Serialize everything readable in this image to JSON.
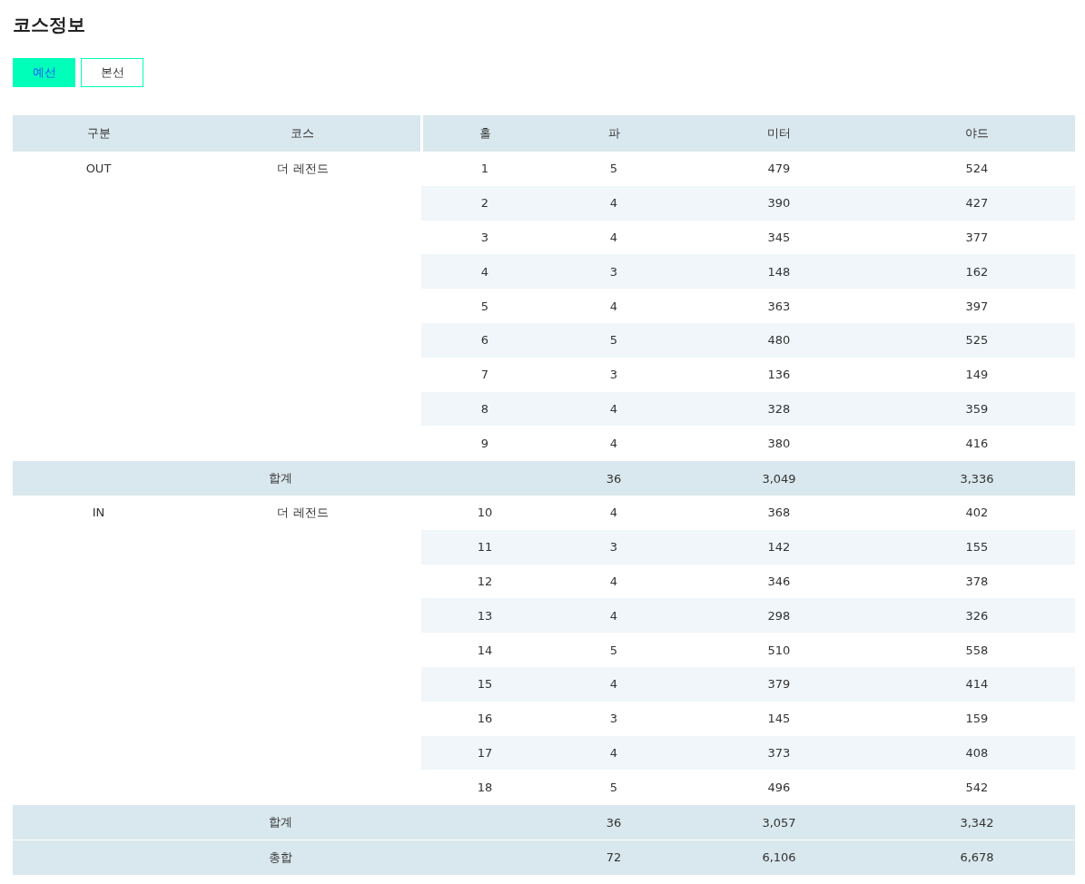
{
  "title": "코스정보",
  "tabs": [
    {
      "label": "예선",
      "selected": true
    },
    {
      "label": "본선",
      "selected": false
    }
  ],
  "table": {
    "columns": [
      "구분",
      "코스",
      "홀",
      "파",
      "미터",
      "야드"
    ],
    "sections": [
      {
        "division": "OUT",
        "course": "더 레전드",
        "rows": [
          {
            "hole": "1",
            "par": "5",
            "meter": "479",
            "yard": "524"
          },
          {
            "hole": "2",
            "par": "4",
            "meter": "390",
            "yard": "427"
          },
          {
            "hole": "3",
            "par": "4",
            "meter": "345",
            "yard": "377"
          },
          {
            "hole": "4",
            "par": "3",
            "meter": "148",
            "yard": "162"
          },
          {
            "hole": "5",
            "par": "4",
            "meter": "363",
            "yard": "397"
          },
          {
            "hole": "6",
            "par": "5",
            "meter": "480",
            "yard": "525"
          },
          {
            "hole": "7",
            "par": "3",
            "meter": "136",
            "yard": "149"
          },
          {
            "hole": "8",
            "par": "4",
            "meter": "328",
            "yard": "359"
          },
          {
            "hole": "9",
            "par": "4",
            "meter": "380",
            "yard": "416"
          }
        ],
        "subtotal": {
          "label": "합계",
          "par": "36",
          "meter": "3,049",
          "yard": "3,336"
        }
      },
      {
        "division": "IN",
        "course": "더 레전드",
        "rows": [
          {
            "hole": "10",
            "par": "4",
            "meter": "368",
            "yard": "402"
          },
          {
            "hole": "11",
            "par": "3",
            "meter": "142",
            "yard": "155"
          },
          {
            "hole": "12",
            "par": "4",
            "meter": "346",
            "yard": "378"
          },
          {
            "hole": "13",
            "par": "4",
            "meter": "298",
            "yard": "326"
          },
          {
            "hole": "14",
            "par": "5",
            "meter": "510",
            "yard": "558"
          },
          {
            "hole": "15",
            "par": "4",
            "meter": "379",
            "yard": "414"
          },
          {
            "hole": "16",
            "par": "3",
            "meter": "145",
            "yard": "159"
          },
          {
            "hole": "17",
            "par": "4",
            "meter": "373",
            "yard": "408"
          },
          {
            "hole": "18",
            "par": "5",
            "meter": "496",
            "yard": "542"
          }
        ],
        "subtotal": {
          "label": "합계",
          "par": "36",
          "meter": "3,057",
          "yard": "3,342"
        }
      }
    ],
    "grand_total": {
      "label": "총합",
      "par": "72",
      "meter": "6,106",
      "yard": "6,678"
    }
  }
}
